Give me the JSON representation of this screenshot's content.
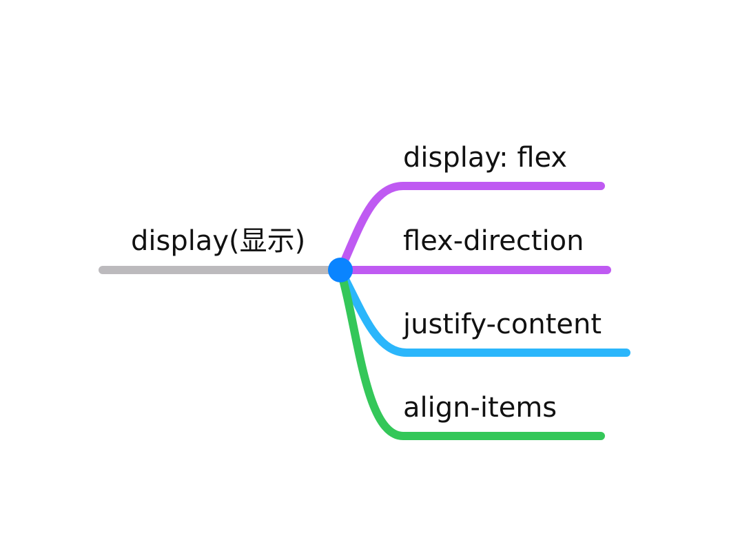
{
  "mindmap": {
    "root": {
      "label": "display(显示)",
      "line_color": "#bcbabd",
      "joint_color": "#0a84ff"
    },
    "branches": [
      {
        "label": "display: flex",
        "color": "#bf5af2"
      },
      {
        "label": "flex-direction",
        "color": "#bf5af2"
      },
      {
        "label": "justify-content",
        "color": "#2bb6fb"
      },
      {
        "label": "align-items",
        "color": "#34c759"
      }
    ]
  }
}
